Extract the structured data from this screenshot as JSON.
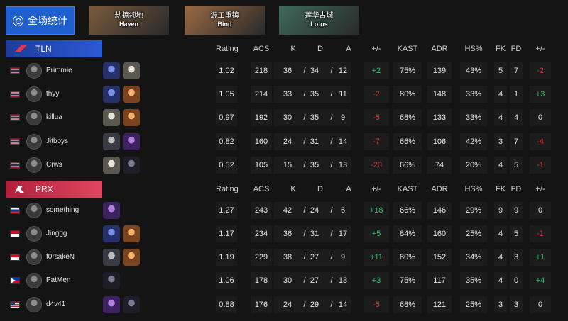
{
  "overall_label": "全场统计",
  "maps": [
    {
      "title": "劫掠领地",
      "name": "Haven",
      "bg": "#7a5a3e"
    },
    {
      "title": "源工重镇",
      "name": "Bind",
      "bg": "#9a6a44"
    },
    {
      "title": "莲华古城",
      "name": "Lotus",
      "bg": "#3e6a5a"
    }
  ],
  "columns": [
    "Rating",
    "ACS",
    "K",
    "D",
    "A",
    "+/-",
    "KAST",
    "ADR",
    "HS%",
    "FK",
    "FD",
    "+/-"
  ],
  "teams": [
    {
      "name": "TLN",
      "players": [
        {
          "flag": "th",
          "name": "Primmie",
          "agents": [
            "a-blue",
            "a-light"
          ],
          "rating": "1.02",
          "acs": "218",
          "k": "36",
          "d": "34",
          "a": "12",
          "diff": "+2",
          "kast": "75%",
          "adr": "139",
          "hs": "43%",
          "fk": "5",
          "fd": "7",
          "fdiff": "-2"
        },
        {
          "flag": "th",
          "name": "thyy",
          "agents": [
            "a-blue",
            "a-orange"
          ],
          "rating": "1.05",
          "acs": "214",
          "k": "33",
          "d": "35",
          "a": "11",
          "diff": "-2",
          "kast": "80%",
          "adr": "148",
          "hs": "33%",
          "fk": "4",
          "fd": "1",
          "fdiff": "+3"
        },
        {
          "flag": "th",
          "name": "killua",
          "agents": [
            "a-light",
            "a-orange"
          ],
          "rating": "0.97",
          "acs": "192",
          "k": "30",
          "d": "35",
          "a": "9",
          "diff": "-5",
          "kast": "68%",
          "adr": "133",
          "hs": "33%",
          "fk": "4",
          "fd": "4",
          "fdiff": "0"
        },
        {
          "flag": "th",
          "name": "Jitboys",
          "agents": [
            "a-gray",
            "a-purple"
          ],
          "rating": "0.82",
          "acs": "160",
          "k": "24",
          "d": "31",
          "a": "14",
          "diff": "-7",
          "kast": "66%",
          "adr": "106",
          "hs": "42%",
          "fk": "3",
          "fd": "7",
          "fdiff": "-4"
        },
        {
          "flag": "th",
          "name": "Crws",
          "agents": [
            "a-light",
            "a-dark"
          ],
          "rating": "0.52",
          "acs": "105",
          "k": "15",
          "d": "35",
          "a": "13",
          "diff": "-20",
          "kast": "66%",
          "adr": "74",
          "hs": "20%",
          "fk": "4",
          "fd": "5",
          "fdiff": "-1"
        }
      ]
    },
    {
      "name": "PRX",
      "players": [
        {
          "flag": "ru",
          "name": "something",
          "agents": [
            "a-purple"
          ],
          "rating": "1.27",
          "acs": "243",
          "k": "42",
          "d": "24",
          "a": "6",
          "diff": "+18",
          "kast": "66%",
          "adr": "146",
          "hs": "29%",
          "fk": "9",
          "fd": "9",
          "fdiff": "0"
        },
        {
          "flag": "id",
          "name": "Jinggg",
          "agents": [
            "a-blue",
            "a-orange"
          ],
          "rating": "1.17",
          "acs": "234",
          "k": "36",
          "d": "31",
          "a": "17",
          "diff": "+5",
          "kast": "84%",
          "adr": "160",
          "hs": "25%",
          "fk": "4",
          "fd": "5",
          "fdiff": "-1"
        },
        {
          "flag": "id",
          "name": "f0rsakeN",
          "agents": [
            "a-gray",
            "a-orange"
          ],
          "rating": "1.19",
          "acs": "229",
          "k": "38",
          "d": "27",
          "a": "9",
          "diff": "+11",
          "kast": "80%",
          "adr": "152",
          "hs": "34%",
          "fk": "4",
          "fd": "3",
          "fdiff": "+1"
        },
        {
          "flag": "ph",
          "name": "PatMen",
          "agents": [
            "a-dark"
          ],
          "rating": "1.06",
          "acs": "178",
          "k": "30",
          "d": "27",
          "a": "13",
          "diff": "+3",
          "kast": "75%",
          "adr": "117",
          "hs": "35%",
          "fk": "4",
          "fd": "0",
          "fdiff": "+4"
        },
        {
          "flag": "us",
          "name": "d4v41",
          "agents": [
            "a-purple",
            "a-dark"
          ],
          "rating": "0.88",
          "acs": "176",
          "k": "24",
          "d": "29",
          "a": "14",
          "diff": "-5",
          "kast": "68%",
          "adr": "121",
          "hs": "25%",
          "fk": "3",
          "fd": "3",
          "fdiff": "0"
        }
      ]
    }
  ]
}
